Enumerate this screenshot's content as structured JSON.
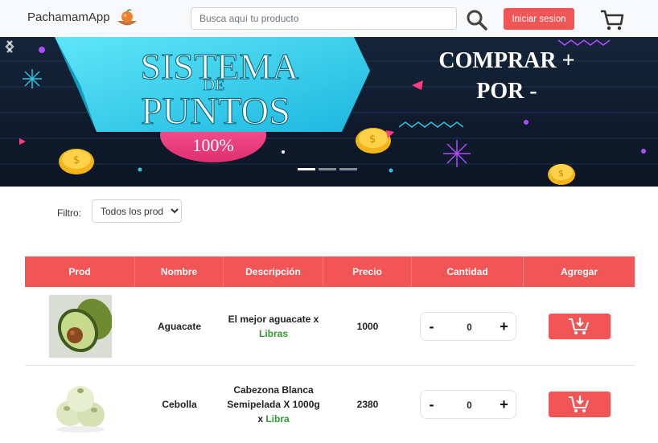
{
  "navbar": {
    "brand": "PachamamApp",
    "search_placeholder": "Busca aquí tu producto",
    "login_label": "Iniciar sesion",
    "icons": {
      "logo": "fruit-basket-icon",
      "search": "search-icon",
      "cart": "cart-icon"
    }
  },
  "banner": {
    "title_line1": "SISTEMA",
    "title_line2": "DE",
    "title_line3": "PUNTOS",
    "percent": "100%",
    "slogan_line1": "COMPRAR +",
    "slogan_line2": "POR -",
    "indicators": 3,
    "active_indicator": 0
  },
  "filter": {
    "label": "Filtro:",
    "selected": "Todos los productos"
  },
  "table": {
    "headers": [
      "Prod",
      "Nombre",
      "Descripción",
      "Precio",
      "Cantidad",
      "Agregar"
    ],
    "rows": [
      {
        "name": "Aguacate",
        "desc_main": "El mejor aguacate x",
        "unit": "Libras",
        "price": "1000",
        "quantity": "0"
      },
      {
        "name": "Cebolla",
        "desc_main": "Cabezona Blanca Semipelada X 1000g x",
        "unit": "Libra",
        "price": "2380",
        "quantity": "0"
      }
    ]
  },
  "colors": {
    "accent": "#f25555",
    "unit_green": "#2e9c2e",
    "navbar_bg": "#f8f9fa",
    "banner_bg": "#0d1a2b"
  }
}
